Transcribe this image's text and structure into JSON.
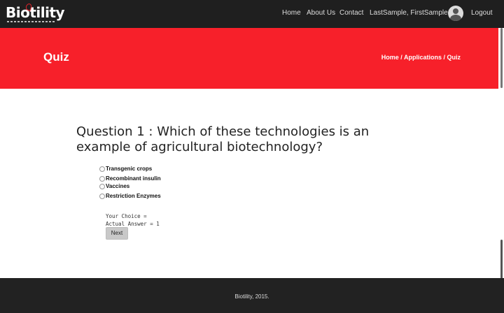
{
  "brand": {
    "name": "Biotility"
  },
  "nav": {
    "items": [
      {
        "label": "Home"
      },
      {
        "label": "About Us"
      },
      {
        "label": "Contact"
      },
      {
        "label": "LastSample, FirstSample"
      }
    ],
    "logout": "Logout"
  },
  "hero": {
    "title": "Quiz",
    "breadcrumb": [
      "Home",
      "Applications",
      "Quiz"
    ],
    "separator": " / "
  },
  "quiz": {
    "question": "Question 1 : Which of these technologies is an example of agricultural biotechnology?",
    "options": [
      {
        "label": "Transgenic crops",
        "selected": false
      },
      {
        "label": "Recombinant insulin",
        "selected": false
      },
      {
        "label": "Vaccines",
        "selected": false
      },
      {
        "label": "Restriction Enzymes",
        "selected": false
      }
    ],
    "your_choice": "Your Choice =",
    "actual_answer": "Actual Answer = 1",
    "next_label": "Next"
  },
  "footer": {
    "text": "Biotility, 2015."
  },
  "colors": {
    "navbar": "#1f1f1f",
    "accent": "#f7202a",
    "footer": "#222222"
  }
}
